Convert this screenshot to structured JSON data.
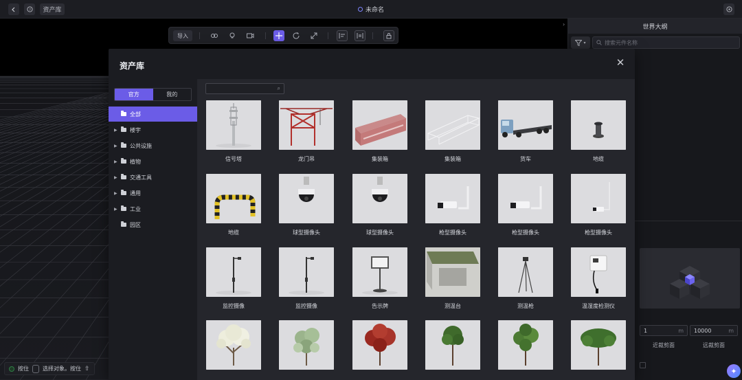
{
  "topbar": {
    "back_icon": "chevron-left-icon",
    "help_icon": "question-circle-icon",
    "asset_lib_button": "资产库",
    "title": "未命名",
    "settings_icon": "settings-circle-icon"
  },
  "toolbar": {
    "import_label": "导入",
    "tools": [
      "link-icon",
      "light-icon",
      "camera-icon",
      "move-icon",
      "rotate-icon",
      "scale-icon",
      "align-icon",
      "distribute-icon",
      "lock-icon"
    ],
    "active_tool": "move-icon"
  },
  "right_panel": {
    "title": "世界大纲",
    "search_placeholder": "搜索元件名称",
    "near_clip": {
      "value": "1",
      "unit": "m",
      "label": "近裁剪面"
    },
    "far_clip": {
      "value": "10000",
      "unit": "m",
      "label": "远裁剪面"
    }
  },
  "hint": {
    "press": "按住",
    "select_text": "选择对象。按住"
  },
  "modal": {
    "title": "资产库",
    "tabs": [
      "官方",
      "我的"
    ],
    "active_tab": "官方",
    "search_placeholder": "",
    "categories": [
      {
        "label": "全部",
        "expandable": false,
        "active": true
      },
      {
        "label": "楼宇",
        "expandable": true,
        "active": false
      },
      {
        "label": "公共设施",
        "expandable": true,
        "active": false
      },
      {
        "label": "植物",
        "expandable": true,
        "active": false
      },
      {
        "label": "交通工具",
        "expandable": true,
        "active": false
      },
      {
        "label": "通用",
        "expandable": true,
        "active": false
      },
      {
        "label": "工业",
        "expandable": true,
        "active": false
      },
      {
        "label": "园区",
        "expandable": false,
        "active": false
      }
    ],
    "assets": [
      {
        "label": "信号塔",
        "thumb": "tower"
      },
      {
        "label": "龙门吊",
        "thumb": "crane"
      },
      {
        "label": "集装箱",
        "thumb": "container"
      },
      {
        "label": "集装箱",
        "thumb": "frame"
      },
      {
        "label": "货车",
        "thumb": "truck"
      },
      {
        "label": "地缆",
        "thumb": "bollard"
      },
      {
        "label": "地缆",
        "thumb": "barrier"
      },
      {
        "label": "球型摄像头",
        "thumb": "dome"
      },
      {
        "label": "球型摄像头",
        "thumb": "dome"
      },
      {
        "label": "枪型摄像头",
        "thumb": "gun"
      },
      {
        "label": "枪型摄像头",
        "thumb": "gun"
      },
      {
        "label": "枪型摄像头",
        "thumb": "gun-small"
      },
      {
        "label": "监控摄像",
        "thumb": "pole"
      },
      {
        "label": "监控摄像",
        "thumb": "pole"
      },
      {
        "label": "告示牌",
        "thumb": "sign"
      },
      {
        "label": "测温台",
        "thumb": "desk"
      },
      {
        "label": "测温枪",
        "thumb": "tripod"
      },
      {
        "label": "温湿度检测仪",
        "thumb": "meter"
      },
      {
        "label": "",
        "thumb": "tree-white"
      },
      {
        "label": "",
        "thumb": "tree-light"
      },
      {
        "label": "",
        "thumb": "tree-red"
      },
      {
        "label": "",
        "thumb": "tree-green"
      },
      {
        "label": "",
        "thumb": "tree-green2"
      },
      {
        "label": "",
        "thumb": "tree-green3"
      }
    ]
  }
}
